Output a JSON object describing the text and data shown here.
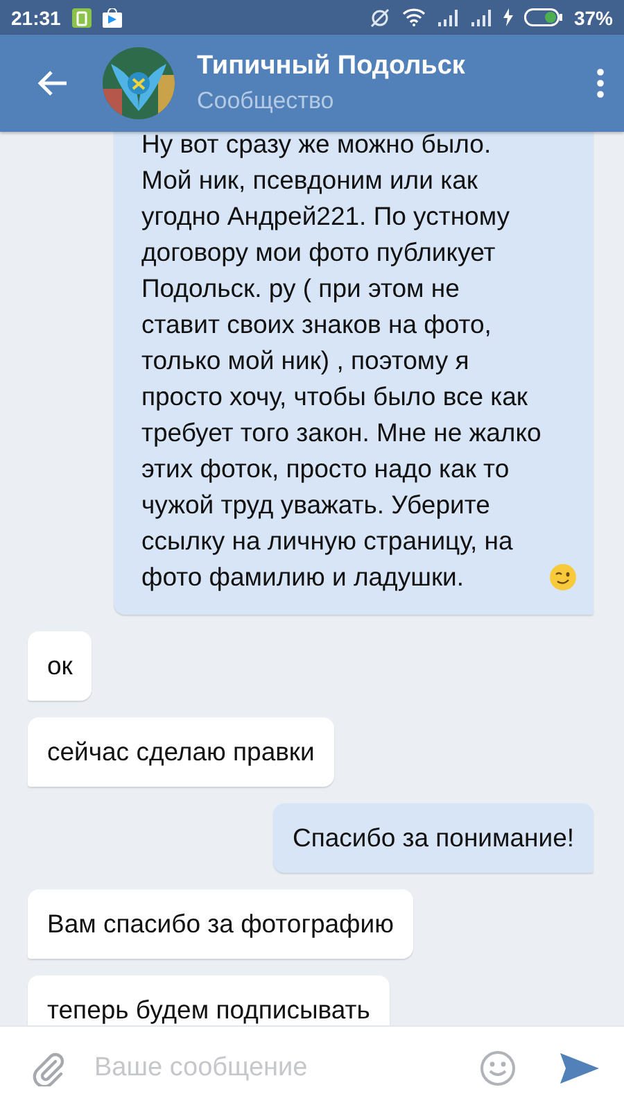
{
  "status_bar": {
    "time": "21:31",
    "battery_percent": "37%"
  },
  "header": {
    "title": "Типичный Подольск",
    "subtitle": "Сообщество"
  },
  "messages": [
    {
      "kind": "outgoing",
      "text": "Ну вот сразу же можно было. Мой ник,  псевдоним или как угодно Андрей221.  По устному договору мои фото публикует Подольск. ру ( при этом не ставит своих знаков на фото, только мой ник) ,  поэтому я просто хочу,  чтобы было все как требует того закон.  Мне не жалко этих фоток,  просто надо как то чужой труд уважать. Уберите ссылку на личную страницу,  на фото фамилию и ладушки.",
      "emoji": {
        "kind": "wink"
      }
    },
    {
      "kind": "incoming",
      "text": "ок"
    },
    {
      "kind": "incoming",
      "text": "сейчас сделаю правки"
    },
    {
      "kind": "outgoing",
      "text": "Спасибо за понимание!"
    },
    {
      "kind": "incoming",
      "text": "Вам спасибо за фотографию"
    },
    {
      "kind": "incoming",
      "text": "теперь будем подписывать"
    }
  ],
  "composer": {
    "placeholder": "Ваше сообщение"
  }
}
